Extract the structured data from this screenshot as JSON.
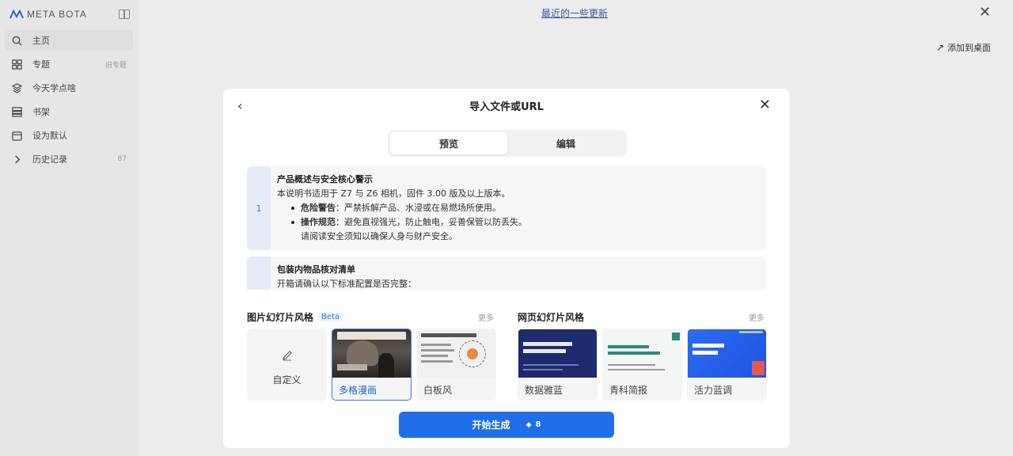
{
  "app": {
    "name": "META BOTA"
  },
  "sidebar": {
    "items": [
      {
        "label": "主页",
        "icon": "search-icon",
        "count": ""
      },
      {
        "label": "专题",
        "icon": "grid-icon",
        "count": "旧专题"
      },
      {
        "label": "今天学点啥",
        "icon": "book-stack-icon",
        "count": ""
      },
      {
        "label": "书架",
        "icon": "bookshelf-icon",
        "count": ""
      },
      {
        "label": "设为默认",
        "icon": "calendar-icon",
        "count": ""
      },
      {
        "label": "历史记录",
        "icon": "chevron-right-icon",
        "count": "87"
      }
    ]
  },
  "topbar": {
    "link": "最近的一些更新",
    "add_desktop": "添加到桌面"
  },
  "modal": {
    "title": "导入文件或URL",
    "tabs": [
      "预览",
      "编辑"
    ],
    "blocks": [
      {
        "num": "1",
        "heading": "产品概述与安全核心警示",
        "intro": "本说明书适用于 Z7 与 Z6 相机，固件 3.00 版及以上版本。",
        "bullets": [
          {
            "bold": "危险警告",
            "text": "：严禁拆解产品、水浸或在易燃场所使用。"
          },
          {
            "bold": "操作规范",
            "text": "：避免直视强光，防止触电，妥善保管以防丢失。"
          }
        ],
        "tail": "请阅读安全须知以确保人身与财产安全。"
      },
      {
        "num": "",
        "heading": "包装内物品核对清单",
        "intro": "开箱请确认以下标准配置是否完整："
      }
    ],
    "image_styles": {
      "title": "图片幻灯片风格",
      "badge": "Beta",
      "more": "更多",
      "cards": [
        {
          "label": "自定义",
          "selected": false
        },
        {
          "label": "多格漫画",
          "selected": true
        },
        {
          "label": "白板风",
          "selected": false
        }
      ]
    },
    "web_styles": {
      "title": "网页幻灯片风格",
      "more": "更多",
      "cards": [
        {
          "label": "数据雅蓝"
        },
        {
          "label": "青科简报"
        },
        {
          "label": "活力蓝调"
        }
      ]
    },
    "generate": {
      "label": "开始生成",
      "cost": "8",
      "cost_icon": "gem-icon"
    }
  },
  "colors": {
    "accent": "#1f6fe8",
    "selected_border": "#3b7be0"
  }
}
